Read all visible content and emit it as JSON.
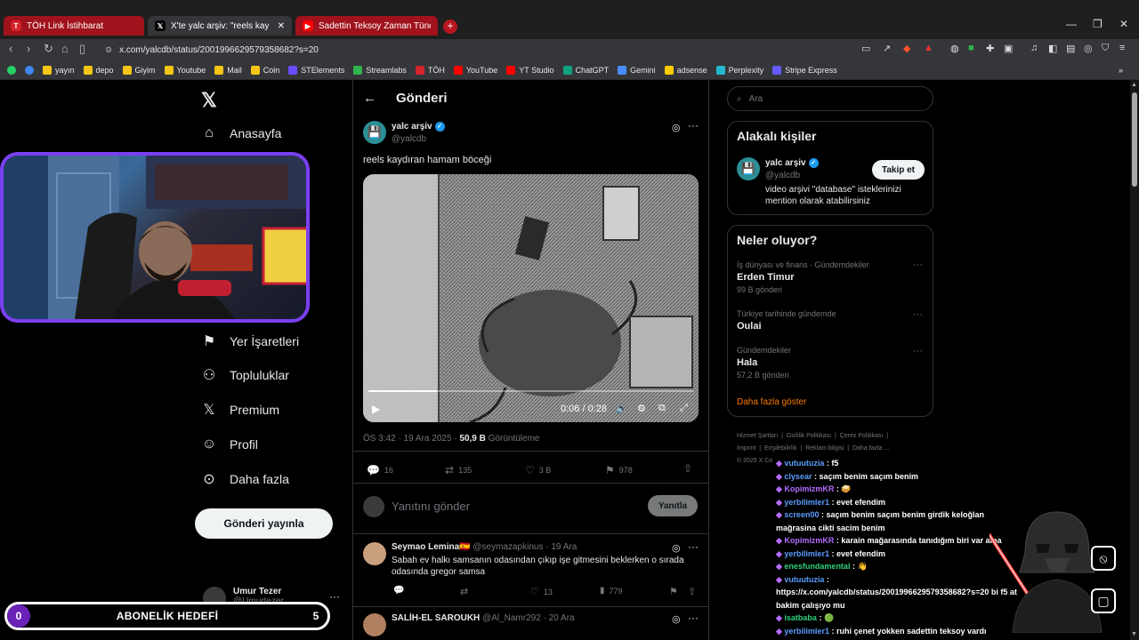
{
  "browser": {
    "tabs": [
      {
        "title": "TÖH Link İstihbarat"
      },
      {
        "title": "X'te yalc arşiv: \"reels kaydıran"
      },
      {
        "title": "Sadettin Teksoy Zaman Tüneli: Bursa'"
      }
    ],
    "url": "x.com/yalcdb/status/2001996629579358682?s=20",
    "bookmarks": [
      "yayın",
      "depo",
      "Giyim",
      "Youtube",
      "Mail",
      "Coin",
      "STElements",
      "Streamlabs",
      "TÖH",
      "YouTube",
      "YT Studio",
      "ChatGPT",
      "Gemini",
      "adsense",
      "Perplexity",
      "Stripe Express"
    ],
    "bookmark_colors": [
      "#f5c518",
      "#f5c518",
      "#f5c518",
      "#f5c518",
      "#f5c518",
      "#f5c518",
      "#6b4cff",
      "#2fb34a",
      "#d4232b",
      "#ff0000",
      "#ff0000",
      "#10a37f",
      "#4a8cff",
      "#ffcc00",
      "#21b8cd",
      "#635bff"
    ]
  },
  "left_nav": {
    "items": [
      "Anasayfa",
      "Yer İşaretleri",
      "Topluluklar",
      "Premium",
      "Profil",
      "Daha fazla"
    ],
    "post_button": "Gönderi yayınla",
    "account": {
      "name": "Umur Tezer",
      "handle": "@Umurtezer"
    }
  },
  "overlay": {
    "sub_goal_label": "ABONELİK HEDEFİ",
    "sub_goal_current": "0",
    "sub_goal_target": "5",
    "sub_goal_progress": 0.04
  },
  "post": {
    "header_title": "Gönderi",
    "author_name": "yalc arşiv",
    "author_handle": "@yalcdb",
    "text": "reels kaydıran hamam böceği",
    "video_time": "0:06 / 0:28",
    "video_progress": 0.21,
    "timestamp": "ÖS 3:42 · 19 Ara 2025 · ",
    "views_count": "50,9 B",
    "views_label": "Görüntüleme",
    "stats": {
      "replies": "16",
      "reposts": "135",
      "likes": "3 B",
      "bookmarks": "978"
    },
    "reply_placeholder": "Yanıtını gönder",
    "reply_button": "Yanıtla"
  },
  "replies": [
    {
      "name": "Seymao Lemina🇪🇸",
      "handle": "@seymazapkinus",
      "date": "· 19 Ara",
      "text": "Sabah ev halkı samsanın odasından çıkıp işe gitmesini beklerken o sırada odasında gregor samsa",
      "likes": "13",
      "views": "779"
    },
    {
      "name": "SALİH-EL SAROUKH",
      "handle": "@Al_Namr292",
      "date": "· 20 Ara"
    }
  ],
  "search": {
    "placeholder": "Ara"
  },
  "relevant": {
    "title": "Alakalı kişiler",
    "name": "yalc arşiv",
    "handle": "@yalcdb",
    "follow": "Takip et",
    "bio": "video arşivi \"database\" isteklerinizi mention olarak atabilirsiniz"
  },
  "trends": {
    "title": "Neler oluyor?",
    "items": [
      {
        "category": "İş dünyası ve finans · Gündemdekiler",
        "name": "Erden Timur",
        "count": "99 B gönderi"
      },
      {
        "category": "Türkiye tarihinde gündemde",
        "name": "Oulai",
        "count": ""
      },
      {
        "category": "Gündemdekiler",
        "name": "Hala",
        "count": "57,2 B gönderi"
      }
    ],
    "show_more": "Daha fazla göster"
  },
  "footer_links": [
    "Hizmet Şartları",
    "Gizlilik Politikası",
    "Çerez Politikası",
    "Imprint",
    "Erişilebilirlik",
    "Reklam bilgisi",
    "Daha fazla ...",
    "© 2025 X Co"
  ],
  "chat": [
    {
      "user": "vutuutuzia",
      "msg": "f5",
      "color": "#5b9cff"
    },
    {
      "user": "clysear",
      "msg": "saçım benim saçım benim",
      "color": "#5b9cff"
    },
    {
      "user": "KopimizmKR",
      "msg": "🥪",
      "color": "#b36bff"
    },
    {
      "user": "yerbilimler1",
      "msg": "evet efendim",
      "color": "#5b9cff"
    },
    {
      "user": "screen00",
      "msg": "saçım benim saçım benim girdik keloğlan mağrasina cikti sacim benim",
      "color": "#5b9cff"
    },
    {
      "user": "KopimizmKR",
      "msg": "karain mağarasında tanıdığım biri var ama",
      "color": "#b36bff"
    },
    {
      "user": "yerbilimler1",
      "msg": "evet efendim",
      "color": "#5b9cff"
    },
    {
      "user": "enesfundamental",
      "msg": "👋",
      "color": "#2fd07a"
    },
    {
      "user": "vutuutuzia",
      "msg": "https://x.com/yalcdb/status/2001996629579358682?s=20 bi f5 at bakim çalışıyo mu",
      "color": "#5b9cff"
    },
    {
      "user": "isatbaba",
      "msg": "🟢",
      "color": "#2fd07a"
    },
    {
      "user": "yerbilimler1",
      "msg": "ruhi çenet yokken sadettin teksoy vardı",
      "color": "#5b9cff"
    }
  ]
}
